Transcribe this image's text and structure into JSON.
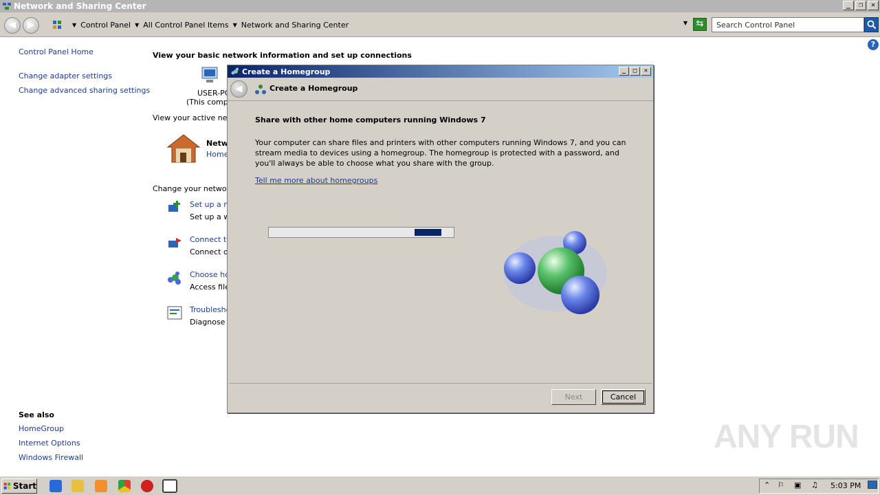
{
  "window": {
    "title": "Network and Sharing Center",
    "controls": {
      "minimize": "_",
      "maximize": "❐",
      "close": "✕"
    }
  },
  "address_bar": {
    "breadcrumbs": [
      "Control Panel",
      "All Control Panel Items",
      "Network and Sharing Center"
    ],
    "search_placeholder": "Search Control Panel"
  },
  "left_pane": {
    "home": "Control Panel Home",
    "links": [
      "Change adapter settings",
      "Change advanced sharing settings"
    ],
    "see_also_title": "See also",
    "see_also": [
      "HomeGroup",
      "Internet Options",
      "Windows Firewall"
    ]
  },
  "main": {
    "heading": "View your basic network information and set up connections",
    "computer_name": "USER-PC",
    "computer_sub": "(This compu",
    "active_networks_label": "View your active netw",
    "network_name": "Netw",
    "network_type": "Home",
    "change_settings_label": "Change your networki",
    "tasks": [
      {
        "title": "Set up a ne",
        "desc": "Set up a wi"
      },
      {
        "title": "Connect to",
        "desc": "Connect or"
      },
      {
        "title": "Choose ho",
        "desc": "Access files"
      },
      {
        "title": "Troublesho",
        "desc": "Diagnose a"
      }
    ]
  },
  "dialog": {
    "title": "Create a Homegroup",
    "nav_title": "Create a Homegroup",
    "heading": "Share with other home computers running Windows 7",
    "body": "Your computer can share files and printers with other computers running Windows 7, and you can stream media to devices using a homegroup. The homegroup is protected with a password, and you'll always be able to choose what you share with the group.",
    "link": "Tell me more about homegroups",
    "next_label": "Next",
    "cancel_label": "Cancel"
  },
  "taskbar": {
    "start_label": "Start",
    "clock": "5:03 PM"
  },
  "watermark": "ANY RUN",
  "colors": {
    "link": "#1b3c94",
    "dialog_title_start": "#0a246a",
    "dialog_title_end": "#a6caf0",
    "progress_fill": "#0a246a"
  }
}
